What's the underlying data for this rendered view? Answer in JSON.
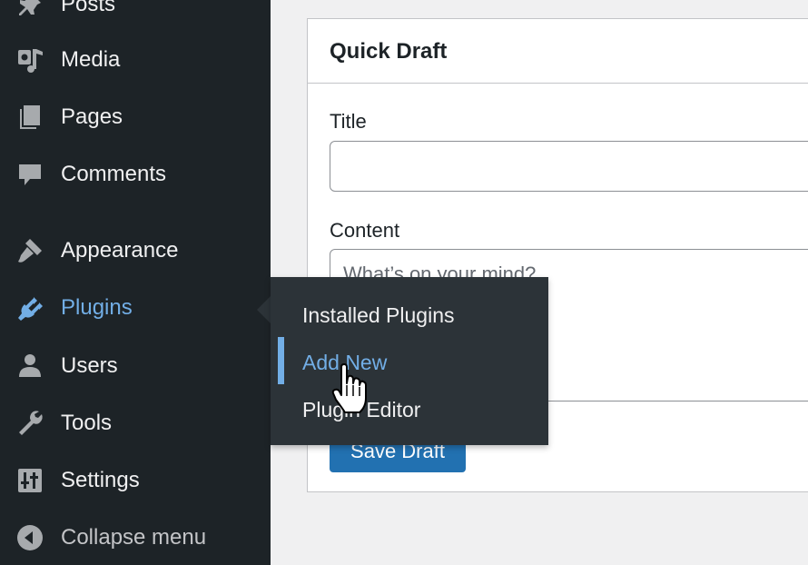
{
  "sidebar": {
    "items": [
      {
        "label": "Posts",
        "icon": "pin-icon"
      },
      {
        "label": "Media",
        "icon": "media-icon"
      },
      {
        "label": "Pages",
        "icon": "pages-icon"
      },
      {
        "label": "Comments",
        "icon": "comments-icon"
      },
      {
        "label": "Appearance",
        "icon": "paintbrush-icon"
      },
      {
        "label": "Plugins",
        "icon": "plugin-icon",
        "active": true
      },
      {
        "label": "Users",
        "icon": "user-icon"
      },
      {
        "label": "Tools",
        "icon": "wrench-icon"
      },
      {
        "label": "Settings",
        "icon": "settings-icon"
      }
    ],
    "collapse_label": "Collapse menu"
  },
  "flyout": {
    "items": [
      {
        "label": "Installed Plugins"
      },
      {
        "label": "Add New",
        "current": true
      },
      {
        "label": "Plugin Editor"
      }
    ]
  },
  "quick_draft": {
    "title": "Quick Draft",
    "title_label": "Title",
    "title_value": "",
    "content_label": "Content",
    "content_placeholder": "What’s on your mind?",
    "save_label": "Save Draft"
  },
  "colors": {
    "sidebar_bg": "#1d2327",
    "flyout_bg": "#2c3338",
    "accent": "#72aee6",
    "button": "#2271b1"
  }
}
